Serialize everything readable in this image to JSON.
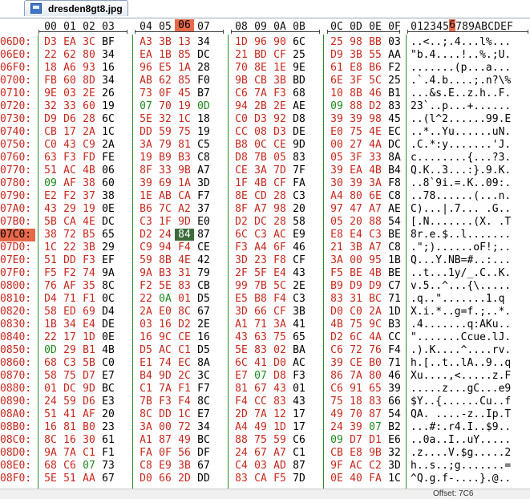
{
  "tab": {
    "filename": "dresden8gt8.jpg",
    "icon": "image-file-icon"
  },
  "columns": [
    "00",
    "01",
    "02",
    "03",
    "04",
    "05",
    "06",
    "07",
    "08",
    "09",
    "0A",
    "0B",
    "0C",
    "0D",
    "0E",
    "0F"
  ],
  "text_header": "0123456789ABCDEF",
  "active_column_index": 6,
  "active_row_offset": "07C0:",
  "selected_byte": {
    "row": 15,
    "col": 6
  },
  "colors": {
    "offset": "#c8281e",
    "active": "#e8684a",
    "grid": "#2a8c2a",
    "selection": "#3b6b3b",
    "red_byte": "#c8281e",
    "green_byte": "#1e8a1e"
  },
  "rows": [
    {
      "offset": "06D0:",
      "bytes": [
        "D3",
        "EA",
        "3C",
        "BF",
        "A3",
        "3B",
        "13",
        "34",
        "1D",
        "96",
        "90",
        "6C",
        "25",
        "98",
        "BB",
        "03"
      ],
      "ascii": "..<..;.4...l%..."
    },
    {
      "offset": "06E0:",
      "bytes": [
        "22",
        "62",
        "80",
        "34",
        "EA",
        "1B",
        "85",
        "DC",
        "21",
        "BD",
        "CF",
        "25",
        "D9",
        "3B",
        "55",
        "AA"
      ],
      "ascii": "\"b.4....!..%.;U."
    },
    {
      "offset": "06F0:",
      "bytes": [
        "18",
        "A6",
        "93",
        "16",
        "96",
        "E5",
        "1A",
        "28",
        "70",
        "8E",
        "1E",
        "9E",
        "61",
        "E8",
        "B6",
        "F2"
      ],
      "ascii": ".......(p...a..."
    },
    {
      "offset": "0700:",
      "bytes": [
        "FB",
        "60",
        "8D",
        "34",
        "AB",
        "62",
        "85",
        "F0",
        "9B",
        "CB",
        "3B",
        "BD",
        "6E",
        "3F",
        "5C",
        "25"
      ],
      "ascii": ".`.4.b....;.n?\\%"
    },
    {
      "offset": "0710:",
      "bytes": [
        "9E",
        "03",
        "2E",
        "26",
        "73",
        "0F",
        "45",
        "B7",
        "C6",
        "7A",
        "F3",
        "68",
        "10",
        "8B",
        "46",
        "B1"
      ],
      "ascii": "...&s.E..z.h..F."
    },
    {
      "offset": "0720:",
      "bytes": [
        "32",
        "33",
        "60",
        "19",
        "07",
        "70",
        "19",
        "0D",
        "94",
        "2B",
        "2E",
        "AE",
        "09",
        "88",
        "D2",
        "83"
      ],
      "ascii": "23`..p...+......"
    },
    {
      "offset": "0730:",
      "bytes": [
        "D9",
        "D6",
        "28",
        "6C",
        "5E",
        "32",
        "1C",
        "18",
        "C0",
        "D3",
        "92",
        "D8",
        "39",
        "39",
        "98",
        "45"
      ],
      "ascii": "..(l^2......99.E"
    },
    {
      "offset": "0740:",
      "bytes": [
        "CB",
        "17",
        "2A",
        "1C",
        "DD",
        "59",
        "75",
        "19",
        "CC",
        "08",
        "D3",
        "DE",
        "E0",
        "75",
        "4E",
        "EC"
      ],
      "ascii": "..*..Yu......uN."
    },
    {
      "offset": "0750:",
      "bytes": [
        "C0",
        "43",
        "C9",
        "2A",
        "3A",
        "79",
        "81",
        "C5",
        "B8",
        "0C",
        "CE",
        "9D",
        "00",
        "27",
        "4A",
        "DC"
      ],
      "ascii": ".C.*:y.......'J."
    },
    {
      "offset": "0760:",
      "bytes": [
        "63",
        "F3",
        "FD",
        "FE",
        "19",
        "B9",
        "B3",
        "C8",
        "D8",
        "7B",
        "05",
        "83",
        "05",
        "3F",
        "33",
        "8A"
      ],
      "ascii": "c........{...?3."
    },
    {
      "offset": "0770:",
      "bytes": [
        "51",
        "AC",
        "4B",
        "06",
        "8F",
        "33",
        "9B",
        "A7",
        "CE",
        "3A",
        "7D",
        "7F",
        "39",
        "EA",
        "4B",
        "B4"
      ],
      "ascii": "Q.K..3...:}.9.K."
    },
    {
      "offset": "0780:",
      "bytes": [
        "09",
        "AF",
        "38",
        "60",
        "39",
        "69",
        "1A",
        "3D",
        "1F",
        "4B",
        "CF",
        "FA",
        "30",
        "39",
        "3A",
        "F8"
      ],
      "ascii": "..8`9i.=.K..09:."
    },
    {
      "offset": "0790:",
      "bytes": [
        "E2",
        "F2",
        "37",
        "38",
        "1E",
        "AB",
        "CA",
        "F7",
        "8E",
        "CD",
        "28",
        "C3",
        "A4",
        "80",
        "6E",
        "C8"
      ],
      "ascii": "..78......(...n."
    },
    {
      "offset": "07A0:",
      "bytes": [
        "43",
        "29",
        "19",
        "0E",
        "B6",
        "7C",
        "A2",
        "37",
        "8F",
        "A7",
        "98",
        "20",
        "97",
        "47",
        "A7",
        "AE"
      ],
      "ascii": "C)...|.7... .G.."
    },
    {
      "offset": "07B0:",
      "bytes": [
        "5B",
        "CA",
        "4E",
        "DC",
        "C3",
        "1F",
        "9D",
        "E0",
        "D2",
        "DC",
        "28",
        "58",
        "05",
        "20",
        "88",
        "54"
      ],
      "ascii": "[.N.......(X. .T"
    },
    {
      "offset": "07C0:",
      "bytes": [
        "38",
        "72",
        "B5",
        "65",
        "D2",
        "24",
        "84",
        "87",
        "6C",
        "C3",
        "AC",
        "E9",
        "E8",
        "E4",
        "C3",
        "BE"
      ],
      "ascii": "8r.e.$..l......."
    },
    {
      "offset": "07D0:",
      "bytes": [
        "1C",
        "22",
        "3B",
        "29",
        "C9",
        "94",
        "F4",
        "CE",
        "F3",
        "A4",
        "6F",
        "46",
        "21",
        "3B",
        "A7",
        "C8"
      ],
      "ascii": ".\";)......oF!;.."
    },
    {
      "offset": "07E0:",
      "bytes": [
        "51",
        "DD",
        "F3",
        "EF",
        "59",
        "8B",
        "4E",
        "42",
        "3D",
        "23",
        "F8",
        "CF",
        "3A",
        "00",
        "95",
        "1B"
      ],
      "ascii": "Q...Y.NB=#..:..."
    },
    {
      "offset": "07F0:",
      "bytes": [
        "F5",
        "F2",
        "74",
        "9A",
        "9A",
        "B3",
        "31",
        "79",
        "2F",
        "5F",
        "E4",
        "43",
        "F5",
        "BE",
        "4B",
        "BE"
      ],
      "ascii": "..t...1y/_.C..K."
    },
    {
      "offset": "0800:",
      "bytes": [
        "76",
        "AF",
        "35",
        "8C",
        "F2",
        "5E",
        "83",
        "CB",
        "99",
        "7B",
        "5C",
        "2E",
        "B9",
        "D9",
        "D9",
        "C7"
      ],
      "ascii": "v.5..^...{\\....."
    },
    {
      "offset": "0810:",
      "bytes": [
        "D4",
        "71",
        "F1",
        "0C",
        "22",
        "0A",
        "01",
        "D5",
        "E5",
        "B8",
        "F4",
        "C3",
        "83",
        "31",
        "BC",
        "71"
      ],
      "ascii": ".q..\".......1.q"
    },
    {
      "offset": "0820:",
      "bytes": [
        "58",
        "ED",
        "69",
        "D4",
        "2A",
        "E0",
        "8C",
        "67",
        "3D",
        "66",
        "CF",
        "3B",
        "D0",
        "C0",
        "2A",
        "1D"
      ],
      "ascii": "X.i.*..g=f.;..*."
    },
    {
      "offset": "0830:",
      "bytes": [
        "1B",
        "34",
        "E4",
        "DE",
        "03",
        "16",
        "D2",
        "2E",
        "A1",
        "71",
        "3A",
        "41",
        "4B",
        "75",
        "9C",
        "B3"
      ],
      "ascii": ".4.......q:AKu.."
    },
    {
      "offset": "0840:",
      "bytes": [
        "22",
        "17",
        "1D",
        "0E",
        "16",
        "9C",
        "CE",
        "16",
        "43",
        "63",
        "75",
        "65",
        "D2",
        "6C",
        "4A",
        "CC"
      ],
      "ascii": "\".......Ccue.lJ."
    },
    {
      "offset": "0850:",
      "bytes": [
        "0D",
        "29",
        "B1",
        "4B",
        "D5",
        "AC",
        "C1",
        "D5",
        "5E",
        "83",
        "02",
        "BA",
        "C6",
        "72",
        "76",
        "F4"
      ],
      "ascii": ".).K....^....rv."
    },
    {
      "offset": "0860:",
      "bytes": [
        "68",
        "C3",
        "5B",
        "C0",
        "E1",
        "74",
        "EC",
        "8A",
        "6C",
        "41",
        "D0",
        "AC",
        "39",
        "CE",
        "B0",
        "71"
      ],
      "ascii": "h.[..t..lA..9..q"
    },
    {
      "offset": "0870:",
      "bytes": [
        "58",
        "75",
        "D7",
        "E7",
        "B4",
        "9D",
        "2C",
        "3C",
        "E7",
        "07",
        "D8",
        "F3",
        "86",
        "7A",
        "80",
        "46"
      ],
      "ascii": "Xu....,<.....z.F"
    },
    {
      "offset": "0880:",
      "bytes": [
        "01",
        "DC",
        "9D",
        "BC",
        "C1",
        "7A",
        "F1",
        "F7",
        "81",
        "67",
        "43",
        "01",
        "C6",
        "91",
        "65",
        "39"
      ],
      "ascii": ".....z...gC...e9"
    },
    {
      "offset": "0890:",
      "bytes": [
        "24",
        "59",
        "D6",
        "E3",
        "7B",
        "F3",
        "F4",
        "8C",
        "F4",
        "CC",
        "83",
        "43",
        "75",
        "18",
        "83",
        "66"
      ],
      "ascii": "$Y..{......Cu..f"
    },
    {
      "offset": "08A0:",
      "bytes": [
        "51",
        "41",
        "AF",
        "20",
        "8C",
        "DD",
        "1C",
        "E7",
        "2D",
        "7A",
        "12",
        "17",
        "49",
        "70",
        "87",
        "54"
      ],
      "ascii": "QA. ....-z..Ip.T"
    },
    {
      "offset": "08B0:",
      "bytes": [
        "16",
        "81",
        "B0",
        "23",
        "3A",
        "00",
        "72",
        "34",
        "A4",
        "49",
        "1D",
        "17",
        "24",
        "39",
        "07",
        "B2"
      ],
      "ascii": "...#:.r4.I..$9.."
    },
    {
      "offset": "08C0:",
      "bytes": [
        "8C",
        "16",
        "30",
        "61",
        "A1",
        "87",
        "49",
        "BC",
        "88",
        "75",
        "59",
        "C6",
        "09",
        "D7",
        "D1",
        "E6"
      ],
      "ascii": "..0a..I..uY....."
    },
    {
      "offset": "08D0:",
      "bytes": [
        "9A",
        "7A",
        "C1",
        "F1",
        "FA",
        "0F",
        "56",
        "DF",
        "24",
        "67",
        "A7",
        "C1",
        "CB",
        "E8",
        "9B",
        "32"
      ],
      "ascii": ".z....V.$g.....2"
    },
    {
      "offset": "08E0:",
      "bytes": [
        "68",
        "C6",
        "07",
        "73",
        "C8",
        "E9",
        "3B",
        "67",
        "C4",
        "03",
        "AD",
        "87",
        "9F",
        "AC",
        "C2",
        "3D"
      ],
      "ascii": "h..s..;g.......="
    },
    {
      "offset": "08F0:",
      "bytes": [
        "5E",
        "51",
        "AA",
        "67",
        "D0",
        "66",
        "2D",
        "DD",
        "83",
        "CA",
        "F5",
        "7D",
        "0E",
        "40",
        "FA",
        "1C"
      ],
      "ascii": "^Q.g.f-....}.@.."
    }
  ],
  "status": {
    "text": "Offset: 7C6"
  }
}
